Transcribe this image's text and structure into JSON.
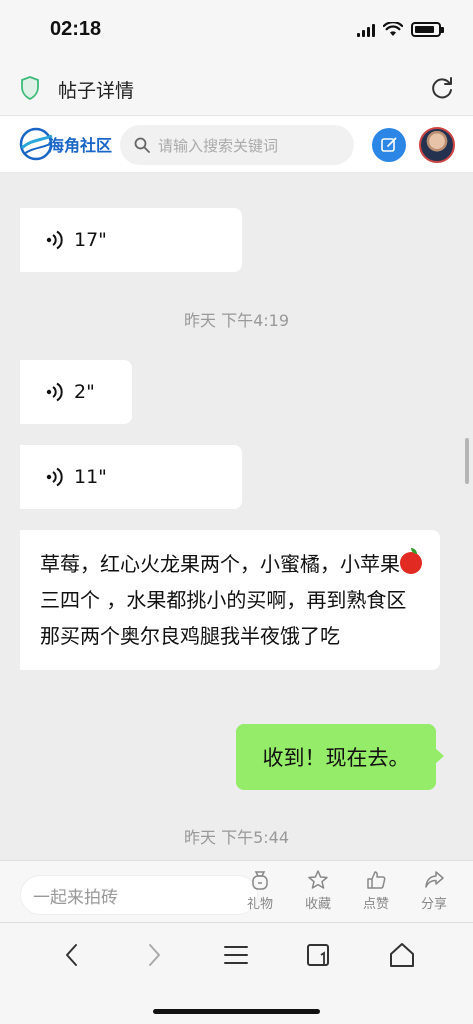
{
  "status_bar": {
    "time": "02:18",
    "battery_level": 0.85
  },
  "title_bar": {
    "title": "帖子详情"
  },
  "site_header": {
    "logo_text": "海角社区",
    "search_placeholder": "请输入搜索关键词"
  },
  "chat": {
    "messages": [
      {
        "type": "voice",
        "duration": "17\""
      },
      {
        "type": "timestamp",
        "text": "昨天 下午4:19"
      },
      {
        "type": "voice",
        "duration": "2\""
      },
      {
        "type": "voice",
        "duration": "11\""
      },
      {
        "type": "text",
        "text_part1": "草莓，红心火龙果两个，小蜜橘，小苹果",
        "text_part2": "三四个 ，水果都挑小的买啊，再到熟食区那买两个奥尔良鸡腿我半夜饿了吃"
      },
      {
        "type": "sent_text",
        "text": "收到！现在去。"
      },
      {
        "type": "timestamp",
        "text": "昨天 下午5:44"
      }
    ]
  },
  "action_bar": {
    "comment_placeholder": "一起来拍砖",
    "gift_label": "礼物",
    "favorite_label": "收藏",
    "like_label": "点赞",
    "share_label": "分享"
  },
  "colors": {
    "accent": "#2c86e6",
    "sent_bubble": "#95ec69",
    "chat_background": "#ededed"
  }
}
